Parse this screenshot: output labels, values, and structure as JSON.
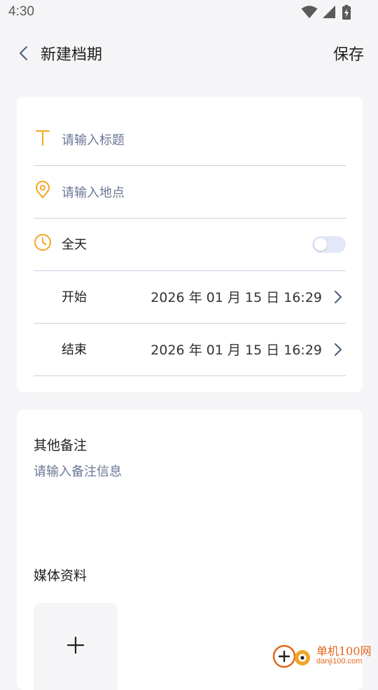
{
  "status_bar": {
    "time": "4:30",
    "icons": [
      "wifi-icon",
      "signal-icon",
      "battery-charging-icon"
    ]
  },
  "header": {
    "title": "新建档期",
    "save_label": "保存",
    "back_icon": "chevron-left-icon"
  },
  "form": {
    "title_placeholder": "请输入标题",
    "location_placeholder": "请输入地点",
    "all_day_label": "全天",
    "all_day_enabled": false,
    "start_label": "开始",
    "start_value": "2026 年 01 月 15 日 16:29",
    "end_label": "结束",
    "end_value": "2026 年 01 月 15 日 16:29"
  },
  "notes": {
    "title": "其他备注",
    "placeholder": "请输入备注信息"
  },
  "media": {
    "title": "媒体资料",
    "add_icon": "plus-icon"
  },
  "watermark": {
    "site_name": "单机100网",
    "site_url": "danji100.com"
  },
  "colors": {
    "accent": "#f5a623",
    "placeholder": "#6b7895",
    "divider": "#c9d3e2",
    "background": "#f5f5f7",
    "toggle_track": "#e2e8f8"
  }
}
